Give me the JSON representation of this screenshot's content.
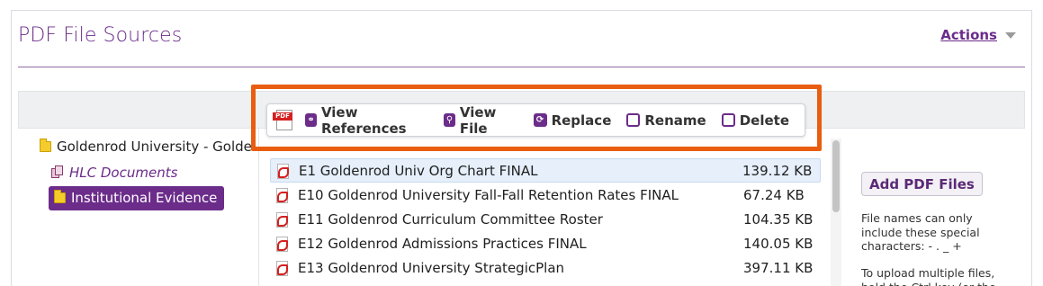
{
  "header": {
    "title": "PDF File Sources",
    "actions_label": "Actions"
  },
  "tree": {
    "root_label": "Goldenrod University - Golde",
    "hlc_label": "HLC Documents",
    "selected_label": "Institutional Evidence"
  },
  "toolbar": {
    "pdf_tag": "PDF",
    "view_references": "View References",
    "view_file": "View File",
    "replace": "Replace",
    "rename": "Rename",
    "delete": "Delete"
  },
  "files": [
    {
      "name": "E1 Goldenrod Univ Org Chart FINAL",
      "size": "139.12 KB"
    },
    {
      "name": "E10 Goldenrod University Fall-Fall Retention Rates FINAL",
      "size": "67.24 KB"
    },
    {
      "name": "E11 Goldenrod Curriculum Committee Roster",
      "size": "104.35 KB"
    },
    {
      "name": "E12 Goldenrod Admissions Practices FINAL",
      "size": "140.05 KB"
    },
    {
      "name": "E13 Goldenrod University StrategicPlan",
      "size": "397.11 KB"
    }
  ],
  "sidebar": {
    "add_button": "Add PDF Files",
    "help_text_1": "File names can only include these special characters: - . _ +",
    "help_text_2": "To upload multiple files, hold the Ctrl key (or the"
  },
  "colors": {
    "accent": "#6b2c8a",
    "highlight": "#e85d10",
    "selected_row": "#e6effa"
  }
}
